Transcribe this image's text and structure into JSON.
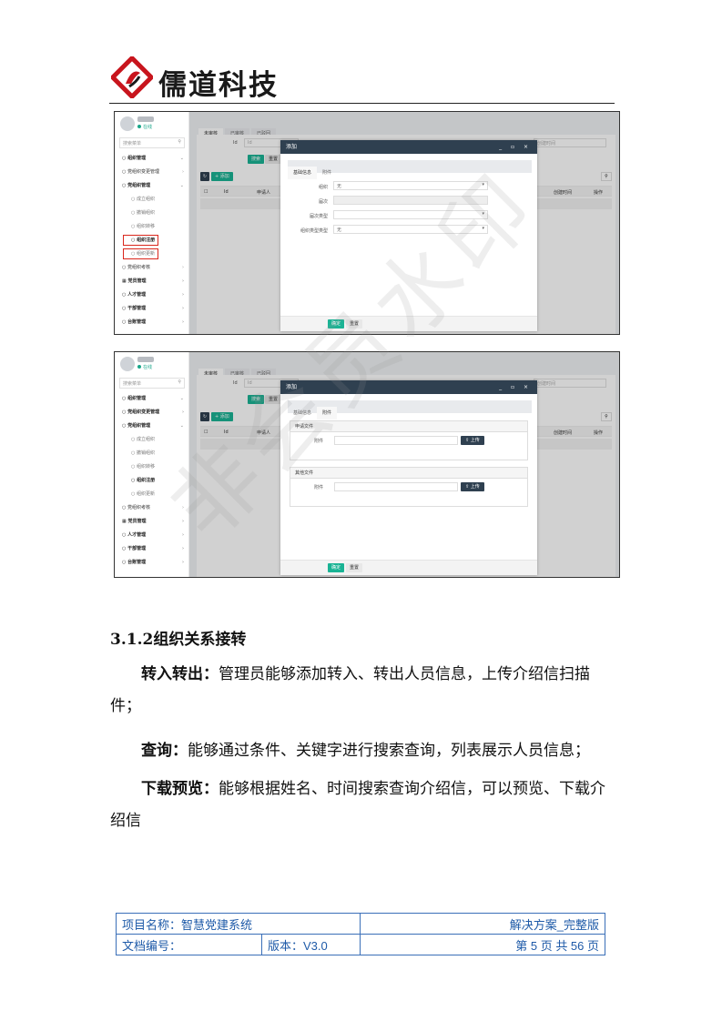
{
  "header": {
    "logo_text": "儒道科技"
  },
  "screenshot1": {
    "sidebar": {
      "status": "在线",
      "search_placeholder": "搜索菜单",
      "menu": [
        {
          "label": "组织管理",
          "level": 0
        },
        {
          "label": "党组织变更管理",
          "level": 0
        },
        {
          "label": "党组织管理",
          "level": 0
        },
        {
          "label": "成立组织",
          "level": 1
        },
        {
          "label": "撤销组织",
          "level": 1
        },
        {
          "label": "组织转移",
          "level": 1
        },
        {
          "label": "组织注册",
          "level": 1,
          "highlight": true
        },
        {
          "label": "组织更新",
          "level": 1,
          "highlight": true
        },
        {
          "label": "党组织考核",
          "level": 0
        },
        {
          "label": "党员管理",
          "level": 0
        },
        {
          "label": "人才管理",
          "level": 0
        },
        {
          "label": "干部管理",
          "level": 0
        },
        {
          "label": "台账管理",
          "level": 0
        }
      ]
    },
    "tabs": [
      "未审核",
      "已审核",
      "已驳回"
    ],
    "filter": {
      "id_label": "Id",
      "id_placeholder": "Id",
      "date_placeholder": "创建时间"
    },
    "buttons": {
      "search": "搜索",
      "reset": "重置",
      "add": "+ 添加"
    },
    "table_headers": [
      "Id",
      "申请人",
      "创建时间",
      "操作"
    ],
    "modal": {
      "title": "添加",
      "tabs": [
        "基础信息",
        "附件"
      ],
      "fields": [
        {
          "label": "组织",
          "value": "无"
        },
        {
          "label": "届次",
          "value": ""
        },
        {
          "label": "届次类型",
          "value": ""
        },
        {
          "label": "组织类型类型",
          "value": "无"
        }
      ],
      "confirm": "确定",
      "reset": "重置"
    }
  },
  "screenshot2": {
    "modal": {
      "title": "添加",
      "tabs": [
        "基础信息",
        "附件"
      ],
      "sections": [
        {
          "title": "申请文件",
          "field_label": "附件",
          "upload": "上传"
        },
        {
          "title": "其他文件",
          "field_label": "附件",
          "upload": "上传"
        }
      ],
      "confirm": "确定",
      "reset": "重置"
    }
  },
  "watermark": "非会员水印",
  "section": {
    "number": "3.1.2",
    "title": "组织关系接转"
  },
  "paragraphs": [
    {
      "lead": "转入转出：",
      "text": "管理员能够添加转入、转出人员信息，上传介绍信扫描件；"
    },
    {
      "lead": "查询：",
      "text": "能够通过条件、关键字进行搜索查询，列表展示人员信息；"
    },
    {
      "lead": "下载预览：",
      "text": "能够根据姓名、时间搜索查询介绍信，可以预览、下载介绍信"
    }
  ],
  "footer": {
    "project_name": "项目名称：智慧党建系统",
    "doc_type": "解决方案_完整版",
    "doc_no": "文档编号：",
    "version": "版本：V3.0",
    "page": "第 5 页 共 56 页"
  }
}
